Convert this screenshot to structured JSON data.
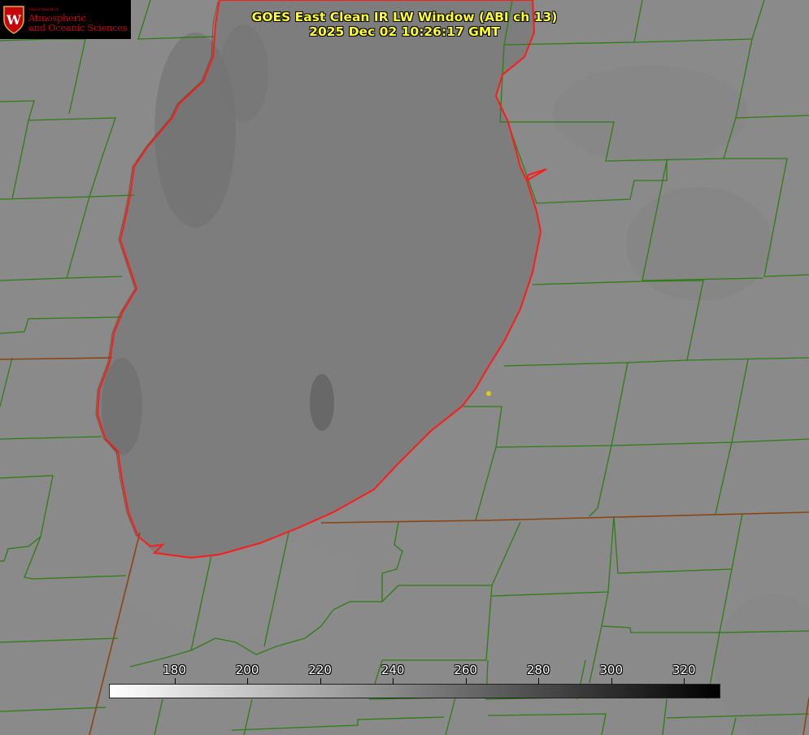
{
  "title": {
    "line1": "GOES East Clean IR LW Window (ABI ch 13)",
    "line2": "2025 Dec 02 10:26:17 GMT"
  },
  "logo": {
    "department": "Department of",
    "line1": "Atmospheric",
    "line2": "and Oceanic Sciences",
    "emblem_letter": "W"
  },
  "colorbar": {
    "min": 162,
    "max": 330,
    "ticks": [
      "180",
      "200",
      "220",
      "240",
      "260",
      "280",
      "300",
      "320"
    ],
    "start_color": "#ffffff",
    "end_color": "#000000"
  },
  "colors": {
    "county_lines": "#2e7d12",
    "lake_shoreline": "#ff1a1a",
    "state_border": "#8b4513",
    "title_text": "#ffff2a",
    "marker": "#e0c814",
    "background": "#8a8a8a",
    "lake": "#7e7e7e"
  }
}
